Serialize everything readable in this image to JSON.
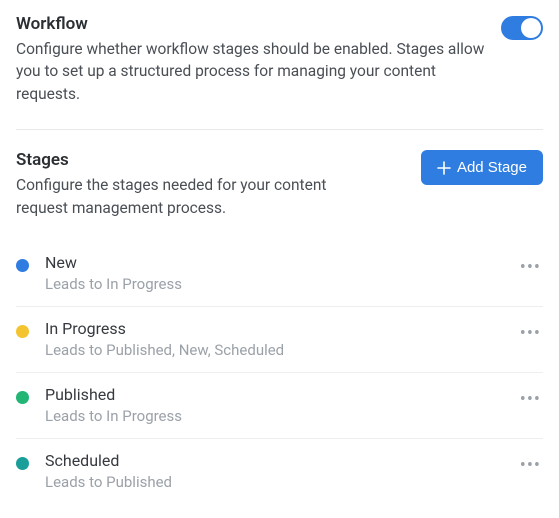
{
  "workflow": {
    "title": "Workflow",
    "description": "Configure whether workflow stages should be enabled. Stages allow you to set up a structured process for managing your content requests.",
    "enabled": true
  },
  "stages_section": {
    "title": "Stages",
    "description": "Configure the stages needed for your content request management process.",
    "add_button_label": "Add Stage"
  },
  "stages": [
    {
      "name": "New",
      "leads": "Leads to In Progress",
      "color": "#2f7de1"
    },
    {
      "name": "In Progress",
      "leads": "Leads to Published, New, Scheduled",
      "color": "#f4c430"
    },
    {
      "name": "Published",
      "leads": "Leads to In Progress",
      "color": "#22b573"
    },
    {
      "name": "Scheduled",
      "leads": "Leads to Published",
      "color": "#1a9e9a"
    }
  ],
  "icons": {
    "more": "•••"
  }
}
